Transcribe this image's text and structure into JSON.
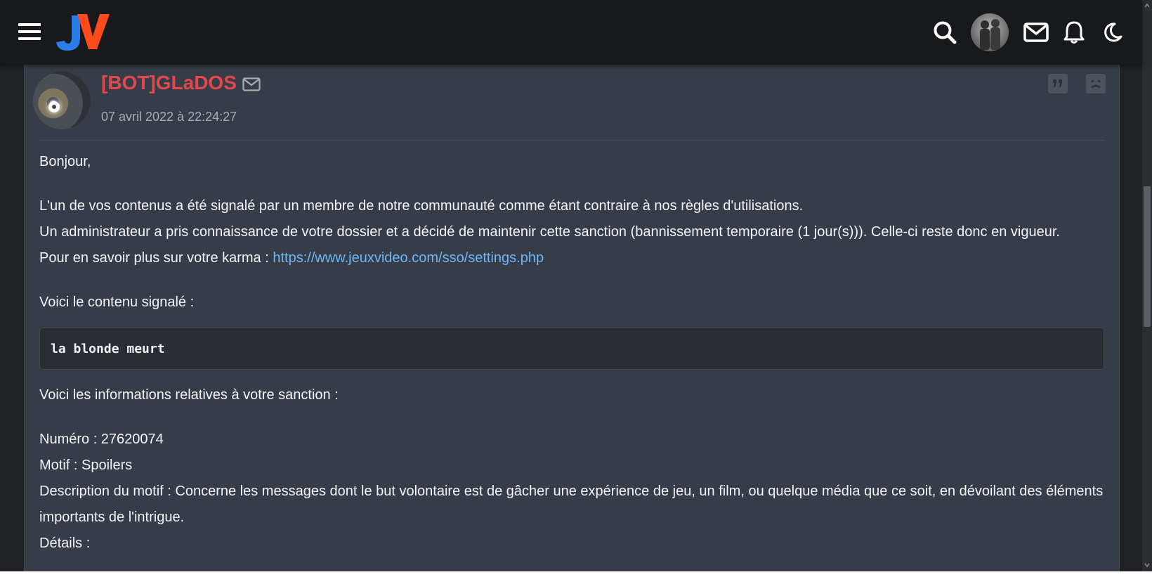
{
  "header": {
    "menu_icon": "hamburger-icon",
    "logo_text": "JV",
    "icons": [
      "search-icon",
      "user-avatar",
      "mail-icon",
      "bell-icon",
      "moon-icon"
    ]
  },
  "post": {
    "author": "[BOT]GLaDOS",
    "date": "07 avril 2022 à 22:24:27",
    "author_color": "#e2474c",
    "actions": [
      "quote-icon",
      "sad-face-icon"
    ],
    "greeting": "Bonjour,",
    "para1": "L'un de vos contenus a été signalé par un membre de notre communauté comme étant contraire à nos règles d'utilisations.",
    "para2": "Un administrateur a pris connaissance de votre dossier et a décidé de maintenir cette sanction (bannissement temporaire (1 jour(s))). Celle-ci reste donc en vigueur.",
    "karma_prefix": "Pour en savoir plus sur votre karma : ",
    "karma_link": "https://www.jeuxvideo.com/sso/settings.php",
    "reported_intro": "Voici le contenu signalé :",
    "reported_content": "la blonde meurt",
    "sanction_intro": "Voici les informations relatives à votre sanction :",
    "numero": "Numéro : 27620074",
    "motif": "Motif : Spoilers",
    "description": "Description du motif : Concerne les messages dont le but volontaire est de gâcher une expérience de jeu, un film, ou quelque média que ce soit, en dévoilant des éléments importants de l'intrigue.",
    "details": "Détails :"
  }
}
